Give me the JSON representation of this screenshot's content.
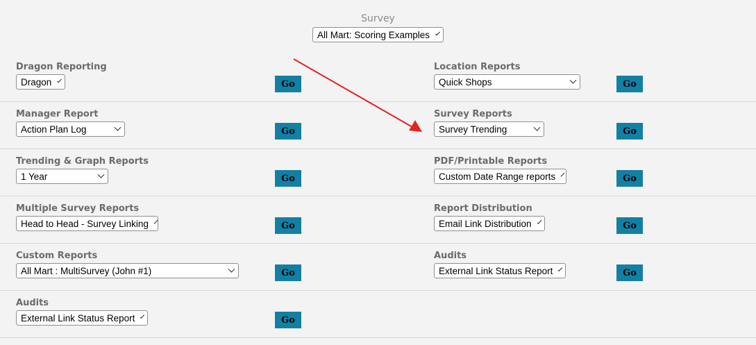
{
  "survey": {
    "label": "Survey",
    "selected": "All Mart: Scoring Examples"
  },
  "go_label": "Go",
  "rows": [
    {
      "left": {
        "label": "Dragon Reporting",
        "selected": "Dragon"
      },
      "right": {
        "label": "Location Reports",
        "selected": "Quick Shops"
      }
    },
    {
      "left": {
        "label": "Manager Report",
        "selected": "Action Plan Log"
      },
      "right": {
        "label": "Survey Reports",
        "selected": "Survey Trending"
      }
    },
    {
      "left": {
        "label": "Trending & Graph Reports",
        "selected": "1 Year"
      },
      "right": {
        "label": "PDF/Printable Reports",
        "selected": "Custom Date Range reports"
      }
    },
    {
      "left": {
        "label": "Multiple Survey Reports",
        "selected": "Head to Head - Survey Linking"
      },
      "right": {
        "label": "Report Distribution",
        "selected": "Email Link Distribution"
      }
    },
    {
      "left": {
        "label": "Custom Reports",
        "selected": "All Mart : MultiSurvey (John #1)"
      },
      "right": {
        "label": "Audits",
        "selected": "External Link Status Report"
      }
    },
    {
      "left": {
        "label": "Audits",
        "selected": "External Link Status Report"
      }
    }
  ],
  "annotation": {
    "arrow_color": "#e52222"
  },
  "colors": {
    "go_button": "#1380a3",
    "label": "#6b6b6b",
    "background": "#f3f3f3"
  },
  "icons": {
    "dropdown": "chevron-down-icon",
    "annotation": "red-arrow-icon"
  }
}
